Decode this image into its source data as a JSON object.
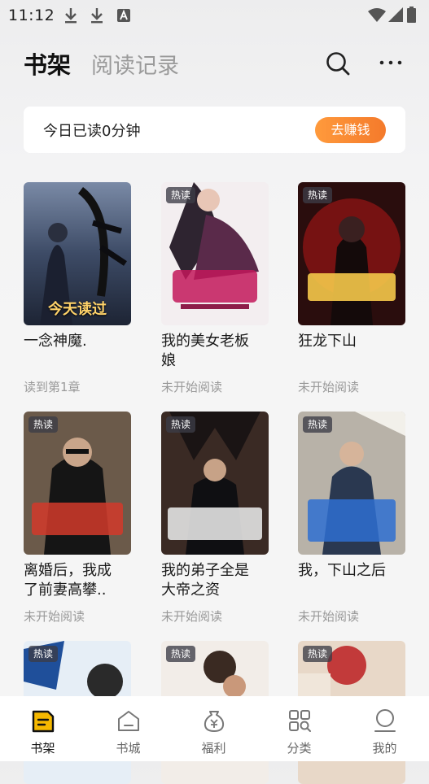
{
  "status_bar": {
    "time": "11:12"
  },
  "header": {
    "tab_shelf": "书架",
    "tab_history": "阅读记录"
  },
  "reading": {
    "text": "今日已读0分钟",
    "earn_button": "去赚钱"
  },
  "books": [
    {
      "title": "一念神魔.",
      "status": "读到第1章",
      "hot": "",
      "tag": "今天读过"
    },
    {
      "title": "我的美女老板娘",
      "status": "未开始阅读",
      "hot": "热读",
      "tag": ""
    },
    {
      "title": "狂龙下山",
      "status": "未开始阅读",
      "hot": "热读",
      "tag": ""
    },
    {
      "title": "离婚后，我成了前妻高攀..",
      "status": "未开始阅读",
      "hot": "热读",
      "tag": ""
    },
    {
      "title": "我的弟子全是大帝之资",
      "status": "未开始阅读",
      "hot": "热读",
      "tag": ""
    },
    {
      "title": "我，下山之后",
      "status": "未开始阅读",
      "hot": "热读",
      "tag": ""
    },
    {
      "hot": "热读"
    },
    {
      "hot": "热读"
    },
    {
      "hot": "热读"
    }
  ],
  "nav": [
    {
      "label": "书架",
      "icon": "bookshelf-icon"
    },
    {
      "label": "书城",
      "icon": "bookstore-icon"
    },
    {
      "label": "福利",
      "icon": "welfare-icon"
    },
    {
      "label": "分类",
      "icon": "category-icon"
    },
    {
      "label": "我的",
      "icon": "profile-icon"
    }
  ],
  "colors": {
    "accent": "#f47a2b",
    "active_nav": "#f5b800"
  }
}
